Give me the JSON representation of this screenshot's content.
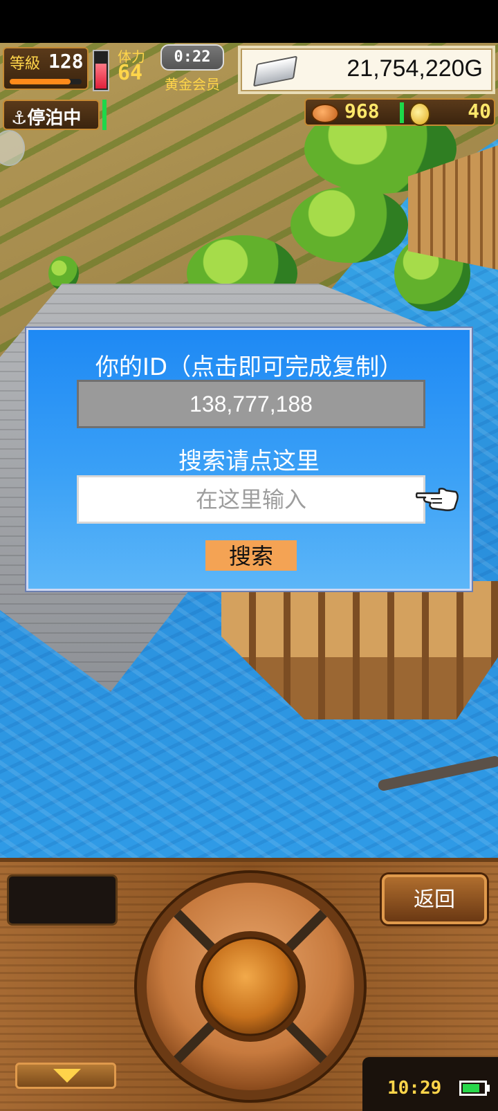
{
  "hud": {
    "level_label": "等級",
    "level_value": "128",
    "level_progress": 0.85,
    "stamina_label": "体力",
    "stamina_value": "64",
    "stamina_gauge_fill": 0.7,
    "timer": "0:22",
    "member_label": "黄金会员",
    "money": "21,754,220G",
    "dock_status": "停泊中",
    "food_value": "968",
    "coin_value": "40"
  },
  "dialog": {
    "id_title": "你的ID（点击即可完成复制）",
    "id_value": "138,777,188",
    "search_title": "搜索请点这里",
    "search_placeholder": "在这里输入",
    "search_value": "",
    "search_button": "搜索"
  },
  "console": {
    "back_button": "返回",
    "clock": "10:29",
    "battery_level": 0.8
  },
  "colors": {
    "dialog_top": "#1e89f4",
    "dialog_bottom": "#5cb6f8",
    "id_box": "#9a9a9a",
    "search_button": "#f4a354",
    "hud_gold": "#ffd54a",
    "status_green": "#1dd84a"
  },
  "icons": [
    "anchor-icon",
    "silver-bar-icon",
    "meat-icon",
    "coin-icon",
    "pointing-hand-icon",
    "down-arrow-icon",
    "battery-icon"
  ]
}
